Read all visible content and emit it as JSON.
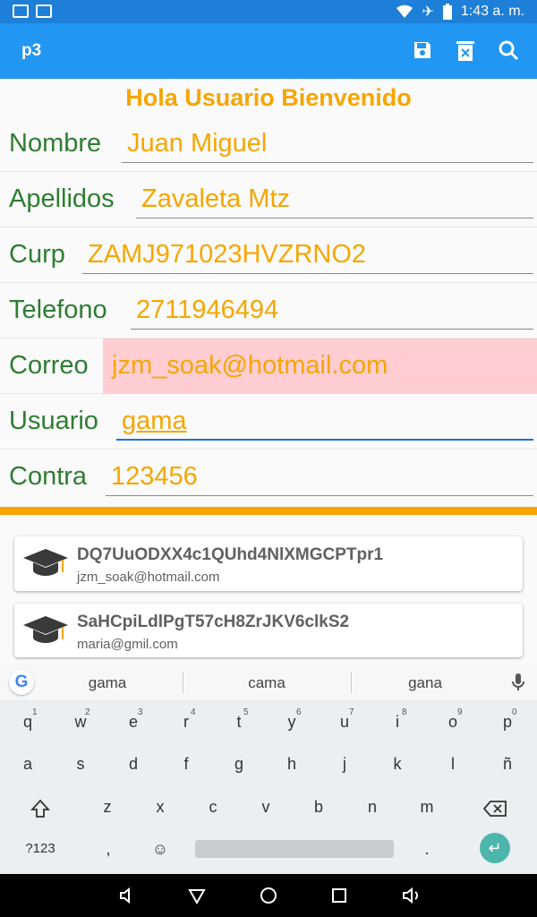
{
  "status": {
    "time": "1:43 a. m."
  },
  "appbar": {
    "title": "p3"
  },
  "form": {
    "header": "Hola Usuario Bienvenido",
    "fields": [
      {
        "label": "Nombre",
        "value": "Juan Miguel"
      },
      {
        "label": "Apellidos",
        "value": "Zavaleta Mtz"
      },
      {
        "label": "Curp",
        "value": "ZAMJ971023HVZRNO2"
      },
      {
        "label": "Telefono",
        "value": "2711946494"
      },
      {
        "label": "Correo",
        "value": "jzm_soak@hotmail.com"
      },
      {
        "label": "Usuario",
        "value": "gama"
      },
      {
        "label": "Contra",
        "value": "123456"
      }
    ]
  },
  "list": [
    {
      "id": "DQ7UuODXX4c1QUhd4NlXMGCPTpr1",
      "email": "jzm_soak@hotmail.com"
    },
    {
      "id": "SaHCpiLdlPgT57cH8ZrJKV6clkS2",
      "email": "maria@gmil.com"
    }
  ],
  "keyboard": {
    "suggestions": [
      "gama",
      "cama",
      "gana"
    ],
    "row1": [
      "q",
      "w",
      "e",
      "r",
      "t",
      "y",
      "u",
      "i",
      "o",
      "p"
    ],
    "row1_nums": [
      "1",
      "2",
      "3",
      "4",
      "5",
      "6",
      "7",
      "8",
      "9",
      "0"
    ],
    "row2": [
      "a",
      "s",
      "d",
      "f",
      "g",
      "h",
      "j",
      "k",
      "l",
      "ñ"
    ],
    "row3": [
      "z",
      "x",
      "c",
      "v",
      "b",
      "n",
      "m"
    ],
    "symbols": "?123",
    "comma": ",",
    "period": "."
  },
  "colors": {
    "primary": "#2196f3",
    "accent": "#f6a600",
    "label": "#2e7d32",
    "highlight": "#ffcdd2"
  }
}
